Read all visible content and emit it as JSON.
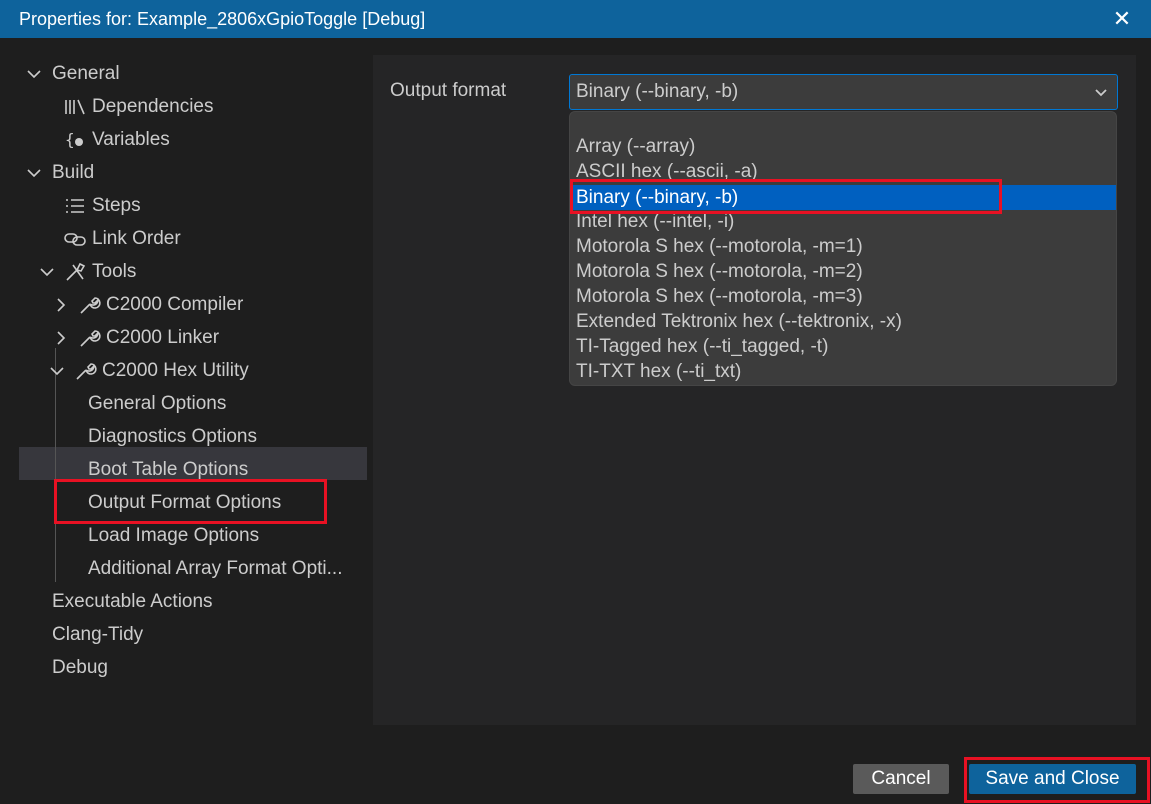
{
  "title": "Properties for: Example_2806xGpioToggle [Debug]",
  "close_glyph": "✕",
  "tree": {
    "general": "General",
    "dependencies": "Dependencies",
    "variables": "Variables",
    "build": "Build",
    "steps": "Steps",
    "link_order": "Link Order",
    "tools": "Tools",
    "compiler": "C2000 Compiler",
    "linker": "C2000 Linker",
    "hex_utility": "C2000 Hex Utility",
    "general_options": "General Options",
    "diagnostics_options": "Diagnostics Options",
    "boot_table_options": "Boot Table Options",
    "output_format_options": "Output Format Options",
    "load_image_options": "Load Image Options",
    "additional_array_options": "Additional Array Format Opti...",
    "executable_actions": "Executable Actions",
    "clang_tidy": "Clang-Tidy",
    "debug": "Debug"
  },
  "output_format": {
    "label": "Output format",
    "selected": "Binary (--binary, -b)",
    "options": [
      "Array (--array)",
      "ASCII hex (--ascii, -a)",
      "Binary (--binary, -b)",
      "Intel hex (--intel, -i)",
      "Motorola S hex (--motorola, -m=1)",
      "Motorola S hex (--motorola, -m=2)",
      "Motorola S hex (--motorola, -m=3)",
      "Extended Tektronix hex (--tektronix, -x)",
      "TI-Tagged hex (--ti_tagged, -t)",
      "TI-TXT hex (--ti_txt)"
    ]
  },
  "buttons": {
    "cancel": "Cancel",
    "save": "Save and Close"
  },
  "colors": {
    "accent": "#0e639c",
    "highlight": "#e81123",
    "selection": "#0060c0"
  }
}
